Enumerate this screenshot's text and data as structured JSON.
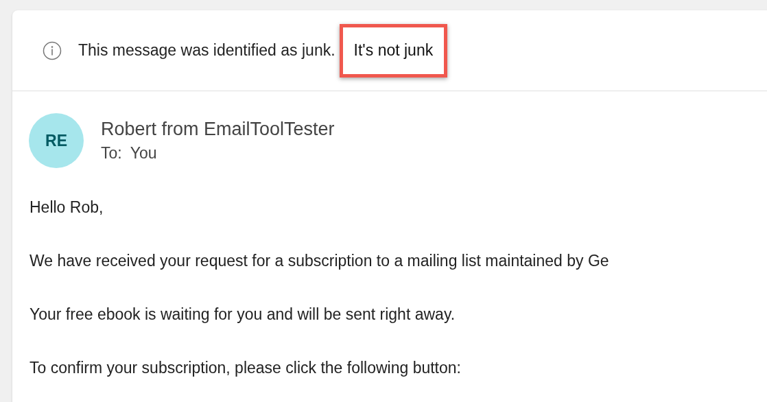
{
  "banner": {
    "message": "This message was identified as junk.",
    "action": "It's not junk",
    "action_highlighted": true
  },
  "sender": {
    "initials": "RE",
    "name": "Robert from EmailToolTester",
    "to_label": "To:",
    "to": "You"
  },
  "body": {
    "paragraphs": [
      "Hello Rob,",
      "We have received your request for a subscription to a mailing list maintained by Ge",
      "Your free ebook is waiting for you and will be sent right away.",
      "To confirm your subscription, please click the following button:"
    ]
  }
}
